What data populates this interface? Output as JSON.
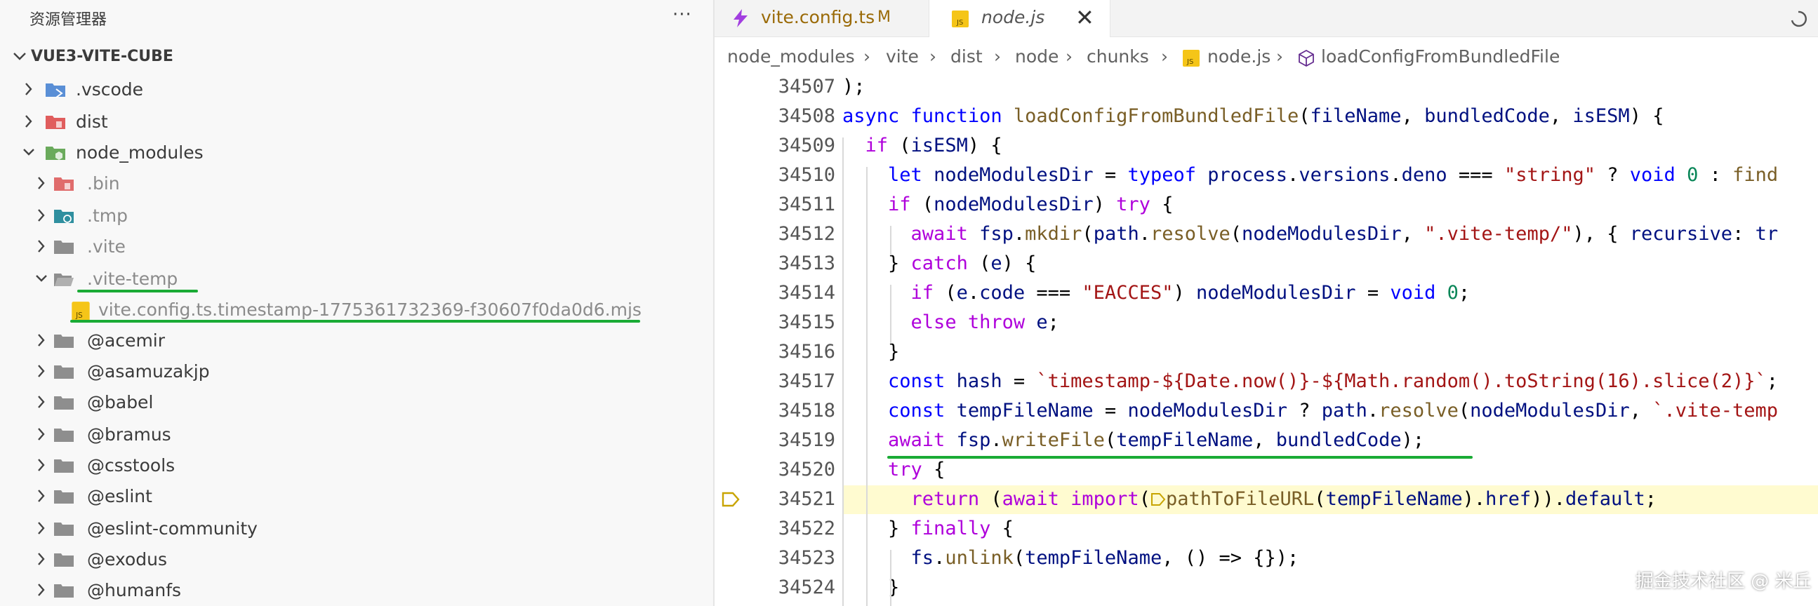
{
  "explorer": {
    "title": "资源管理器",
    "more_label": "···",
    "project": "VUE3-VITE-CUBE",
    "items": [
      {
        "label": ".vscode",
        "icon": "vscode-folder-icon",
        "state": "collapsed"
      },
      {
        "label": "dist",
        "icon": "dist-folder-icon",
        "state": "collapsed"
      },
      {
        "label": "node_modules",
        "icon": "node-modules-folder-icon",
        "state": "expanded"
      },
      {
        "label": ".bin",
        "icon": "bin-folder-icon",
        "state": "collapsed"
      },
      {
        "label": ".tmp",
        "icon": "tmp-folder-icon",
        "state": "collapsed"
      },
      {
        "label": ".vite",
        "icon": "folder-icon",
        "state": "collapsed"
      },
      {
        "label": ".vite-temp",
        "icon": "folder-open-icon",
        "state": "expanded"
      },
      {
        "label": "vite.config.ts.timestamp-1775361732369-f30607f0da0d6.mjs",
        "icon": "js-file-icon",
        "state": "file"
      },
      {
        "label": "@acemir",
        "icon": "folder-icon",
        "state": "collapsed"
      },
      {
        "label": "@asamuzakjp",
        "icon": "folder-icon",
        "state": "collapsed"
      },
      {
        "label": "@babel",
        "icon": "folder-icon",
        "state": "collapsed"
      },
      {
        "label": "@bramus",
        "icon": "folder-icon",
        "state": "collapsed"
      },
      {
        "label": "@csstools",
        "icon": "folder-icon",
        "state": "collapsed"
      },
      {
        "label": "@eslint",
        "icon": "folder-icon",
        "state": "collapsed"
      },
      {
        "label": "@eslint-community",
        "icon": "folder-icon",
        "state": "collapsed"
      },
      {
        "label": "@exodus",
        "icon": "folder-icon",
        "state": "collapsed"
      },
      {
        "label": "@humanfs",
        "icon": "folder-icon",
        "state": "collapsed"
      }
    ]
  },
  "tabs": [
    {
      "label": "vite.config.ts",
      "badge": "M",
      "icon": "vite-icon"
    },
    {
      "label": "node.js",
      "close": "✕",
      "icon": "js-file-icon"
    }
  ],
  "breadcrumb": [
    "node_modules",
    "vite",
    "dist",
    "node",
    "chunks",
    "node.js",
    "loadConfigFromBundledFile"
  ],
  "editor": {
    "line_numbers": [
      "34507",
      "34508",
      "34509",
      "34510",
      "34511",
      "34512",
      "34513",
      "34514",
      "34515",
      "34516",
      "34517",
      "34518",
      "34519",
      "34520",
      "34521",
      "34522",
      "34523",
      "34524"
    ],
    "highlighted_line": "34521",
    "lines": [
      ");",
      "async function loadConfigFromBundledFile(fileName, bundledCode, isESM) {",
      "  if (isESM) {",
      "    let nodeModulesDir = typeof process.versions.deno === \"string\" ? void 0 : find",
      "    if (nodeModulesDir) try {",
      "      await fsp.mkdir(path.resolve(nodeModulesDir, \".vite-temp/\"), { recursive: tr",
      "    } catch (e) {",
      "      if (e.code === \"EACCES\") nodeModulesDir = void 0;",
      "      else throw e;",
      "    }",
      "    const hash = `timestamp-${Date.now()}-${Math.random().toString(16).slice(2)}`;",
      "    const tempFileName = nodeModulesDir ? path.resolve(nodeModulesDir, `.vite-temp",
      "    await fsp.writeFile(tempFileName, bundledCode);",
      "    try {",
      "      return (await import(pathToFileURL(tempFileName).href)).default;",
      "    } finally {",
      "      fs.unlink(tempFileName, () => {});",
      "    }"
    ]
  },
  "watermark": "掘金技术社区 @ 米丘",
  "colors": {
    "annotation": "#1aab35",
    "highlight": "#fffbd0"
  }
}
